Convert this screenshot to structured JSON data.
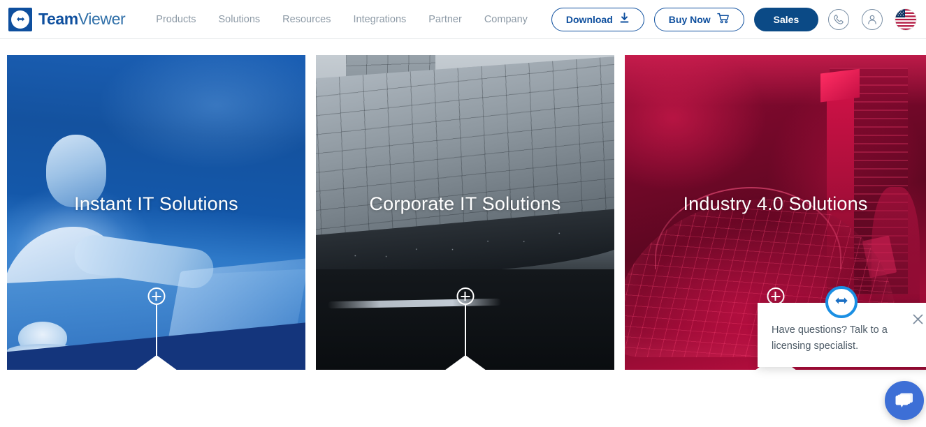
{
  "header": {
    "brand": {
      "bold": "Team",
      "light": "Viewer",
      "logo_icon": "teamviewer-arrows-icon"
    },
    "nav": [
      {
        "label": "Products"
      },
      {
        "label": "Solutions"
      },
      {
        "label": "Resources"
      },
      {
        "label": "Integrations"
      },
      {
        "label": "Partner"
      },
      {
        "label": "Company"
      }
    ],
    "buttons": {
      "download": {
        "label": "Download",
        "icon": "download-icon"
      },
      "buy_now": {
        "label": "Buy Now",
        "icon": "cart-icon"
      },
      "sales": {
        "label": "Sales"
      }
    },
    "utilities": [
      {
        "icon": "phone-icon"
      },
      {
        "icon": "user-account-icon"
      },
      {
        "icon": "us-flag-icon"
      }
    ]
  },
  "cards": [
    {
      "title": "Instant IT Solutions",
      "expand_icon": "plus-circle-icon",
      "theme": "blue"
    },
    {
      "title": "Corporate IT Solutions",
      "expand_icon": "plus-circle-icon",
      "theme": "grey"
    },
    {
      "title": "Industry 4.0 Solutions",
      "expand_icon": "plus-circle-icon",
      "theme": "red"
    }
  ],
  "chat": {
    "message": "Have questions? Talk to a licensing specialist.",
    "close_icon": "close-icon",
    "badge_icon": "teamviewer-arrows-icon",
    "fab_icon": "chat-bubbles-icon"
  },
  "colors": {
    "brand_blue": "#0e4f9e",
    "sales_blue": "#0b4a86",
    "nav_grey": "#8d9aa6",
    "chat_blue": "#3d6fd6",
    "badge_blue": "#1a8fe3"
  }
}
